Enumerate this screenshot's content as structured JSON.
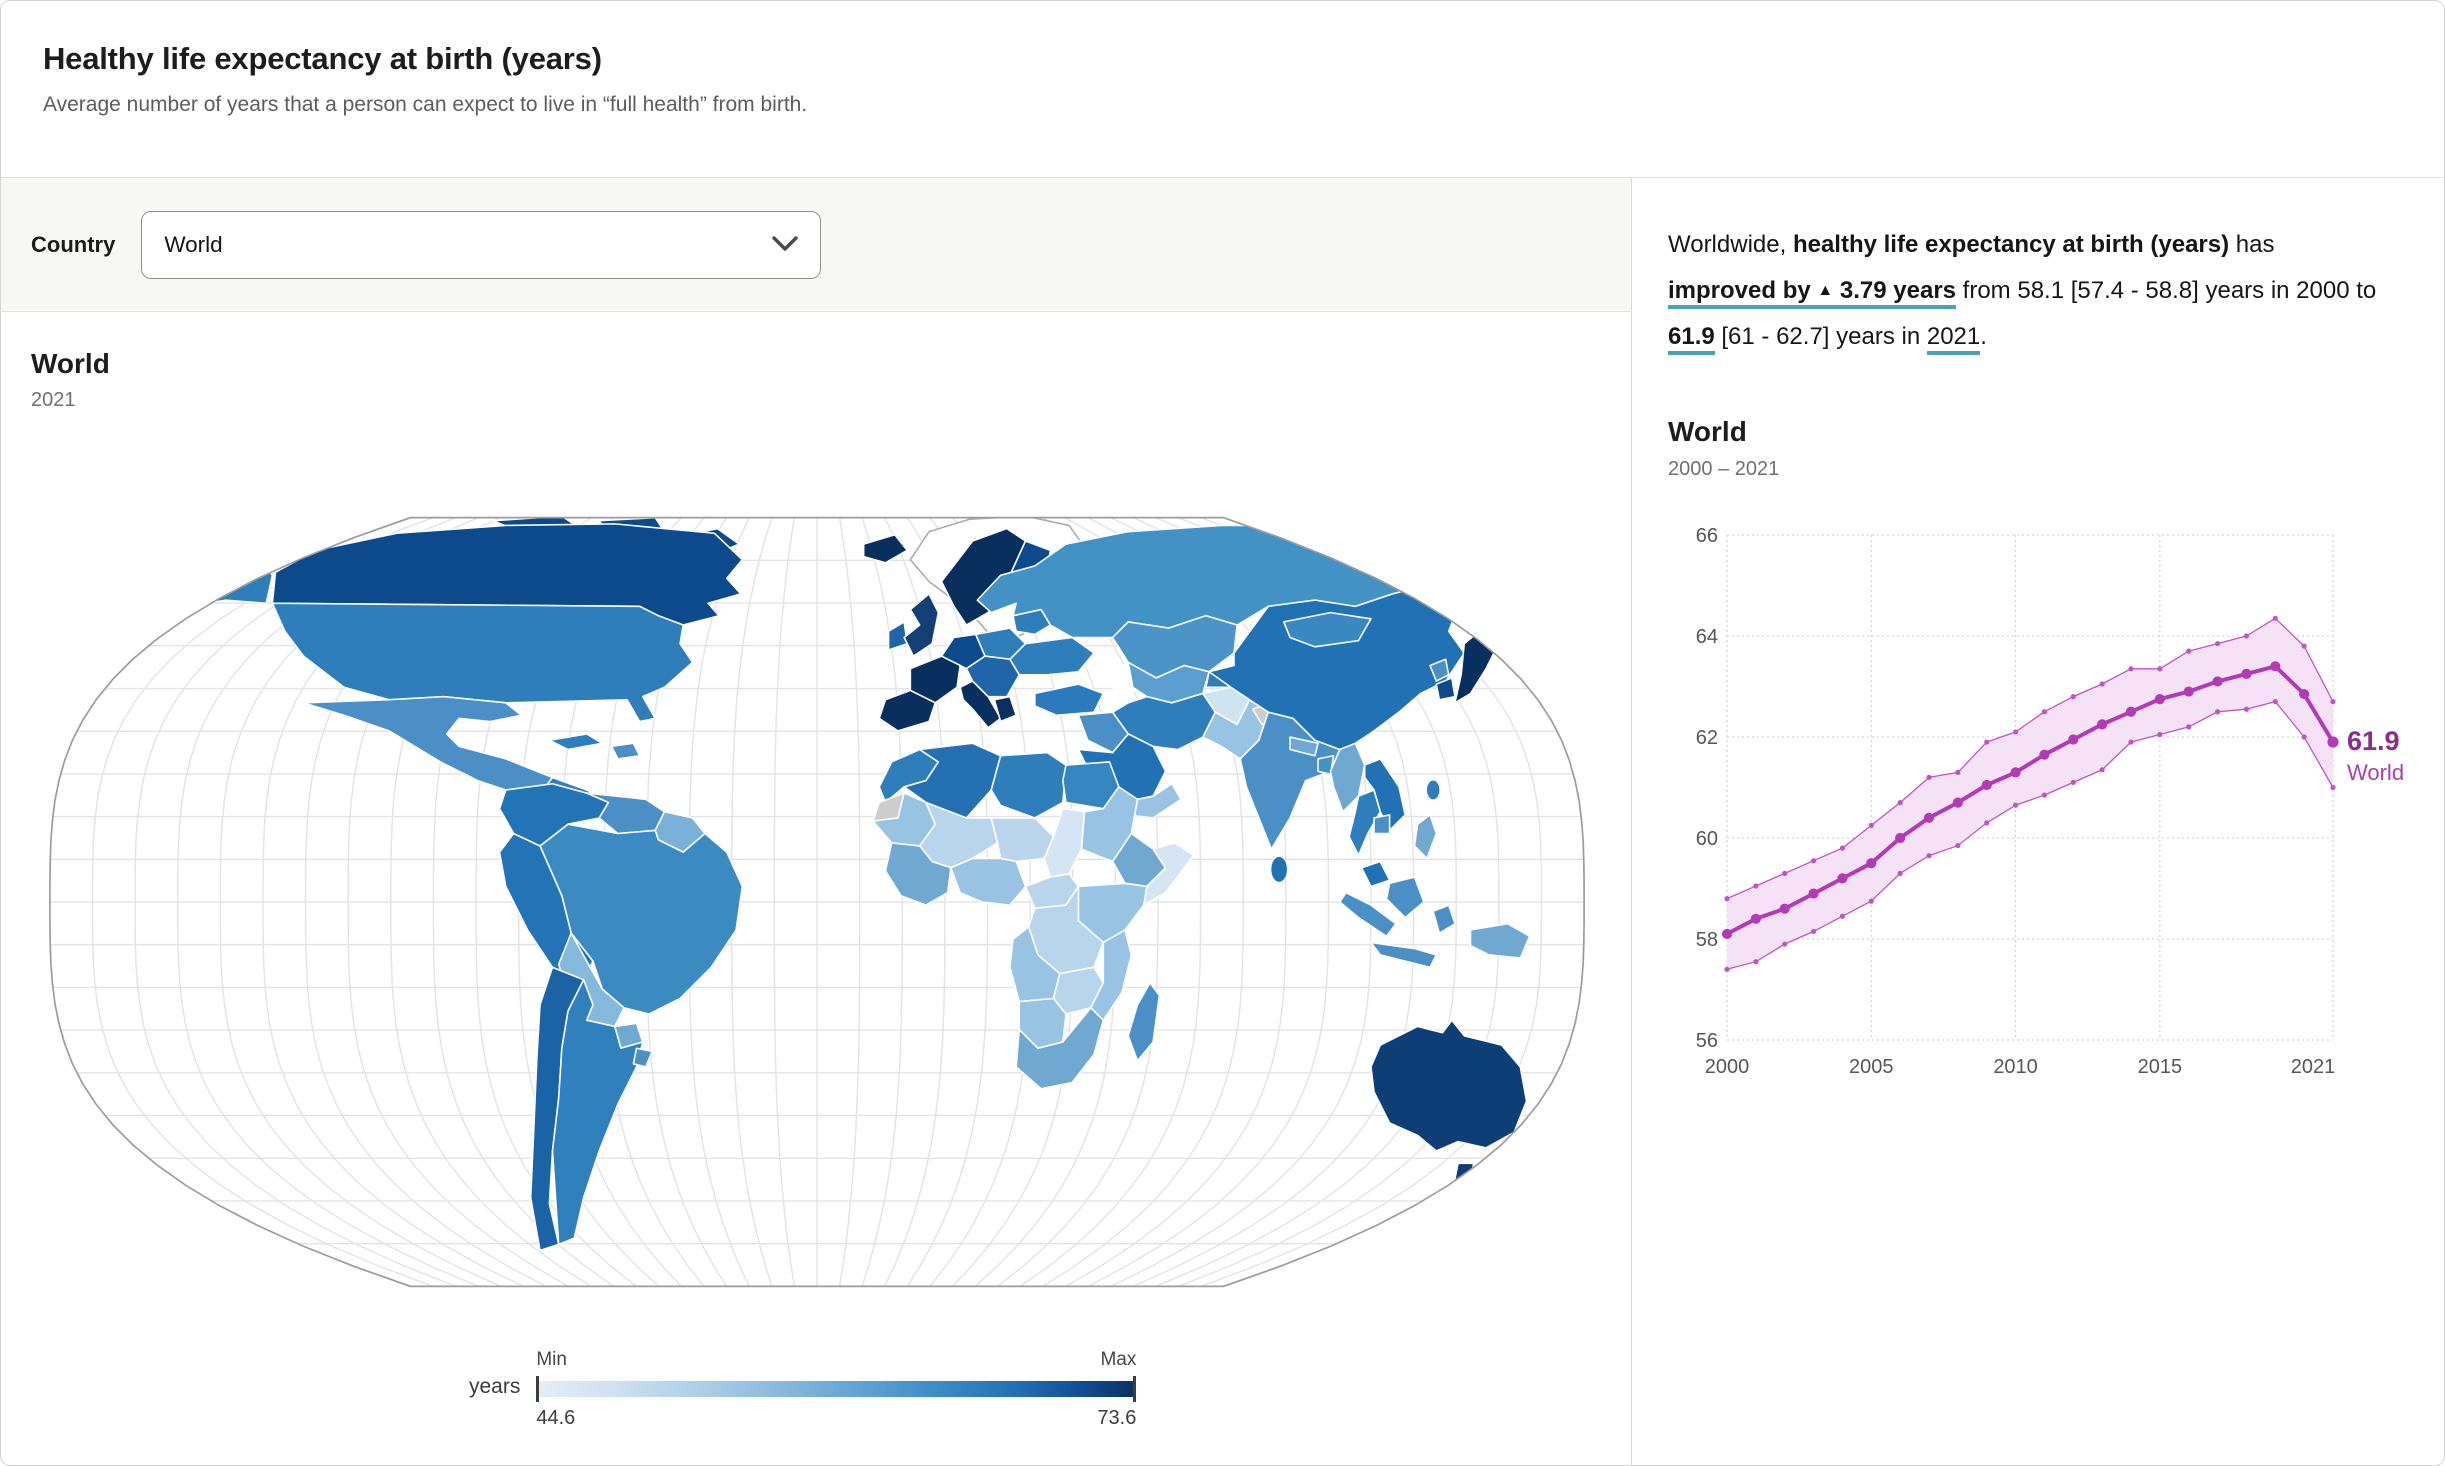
{
  "header": {
    "title": "Healthy life expectancy at birth (years)",
    "subtitle": "Average number of years that a person can expect to live in “full health” from birth."
  },
  "controls": {
    "label": "Country",
    "selected": "World"
  },
  "map": {
    "title": "World",
    "year": "2021",
    "legend": {
      "unit": "years",
      "min_label": "Min",
      "max_label": "Max",
      "min_value": "44.6",
      "max_value": "73.6"
    },
    "colors": {
      "scale_low": "#e4eef8",
      "scale_high": "#0a3266",
      "no_data": "#cdcdcd"
    }
  },
  "summary": {
    "prefix": "Worldwide,",
    "metric": "healthy life expectancy at birth (years)",
    "verb": "has",
    "change_label": "improved by",
    "arrow": "▲",
    "change_value": "3.79 years",
    "from_text": "from 58.1 [57.4 - 58.8] years in 2000 to",
    "to_value": "61.9",
    "range_text": "[61 - 62.7] years in",
    "to_year": "2021",
    "period": "."
  },
  "chart": {
    "title": "World",
    "subtitle": "2000 – 2021"
  },
  "chart_data": {
    "type": "line",
    "title": "World",
    "subtitle": "2000 – 2021",
    "x": [
      2000,
      2001,
      2002,
      2003,
      2004,
      2005,
      2006,
      2007,
      2008,
      2009,
      2010,
      2011,
      2012,
      2013,
      2014,
      2015,
      2016,
      2017,
      2018,
      2019,
      2020,
      2021
    ],
    "series": [
      {
        "name": "World",
        "values": [
          58.1,
          58.4,
          58.6,
          58.9,
          59.2,
          59.5,
          60.0,
          60.4,
          60.7,
          61.05,
          61.3,
          61.65,
          61.95,
          62.25,
          62.5,
          62.75,
          62.9,
          63.1,
          63.25,
          63.4,
          62.85,
          61.9
        ]
      }
    ],
    "band": {
      "upper": [
        58.8,
        59.05,
        59.3,
        59.55,
        59.8,
        60.25,
        60.7,
        61.2,
        61.3,
        61.9,
        62.1,
        62.5,
        62.8,
        63.05,
        63.35,
        63.35,
        63.7,
        63.85,
        64.0,
        64.35,
        63.8,
        62.7
      ],
      "lower": [
        57.4,
        57.55,
        57.9,
        58.15,
        58.45,
        58.75,
        59.3,
        59.65,
        59.85,
        60.3,
        60.65,
        60.85,
        61.1,
        61.35,
        61.9,
        62.05,
        62.2,
        62.5,
        62.55,
        62.7,
        62.0,
        61.0
      ]
    },
    "ylim": [
      56,
      66
    ],
    "yticks": [
      56,
      58,
      60,
      62,
      64,
      66
    ],
    "xticks": [
      2000,
      2005,
      2010,
      2015,
      2021
    ],
    "grid": "dotted",
    "legend_position": "end-of-line",
    "end_label": {
      "value": "61.9",
      "name": "World"
    },
    "colors": {
      "line": "#b23ab5",
      "band": "#f5e2f6",
      "band_edge": "#bf55c3",
      "label_value": "#8b2b91",
      "label_name": "#a73fad",
      "grid": "#c9c9c9",
      "axis_text": "#565656"
    }
  }
}
